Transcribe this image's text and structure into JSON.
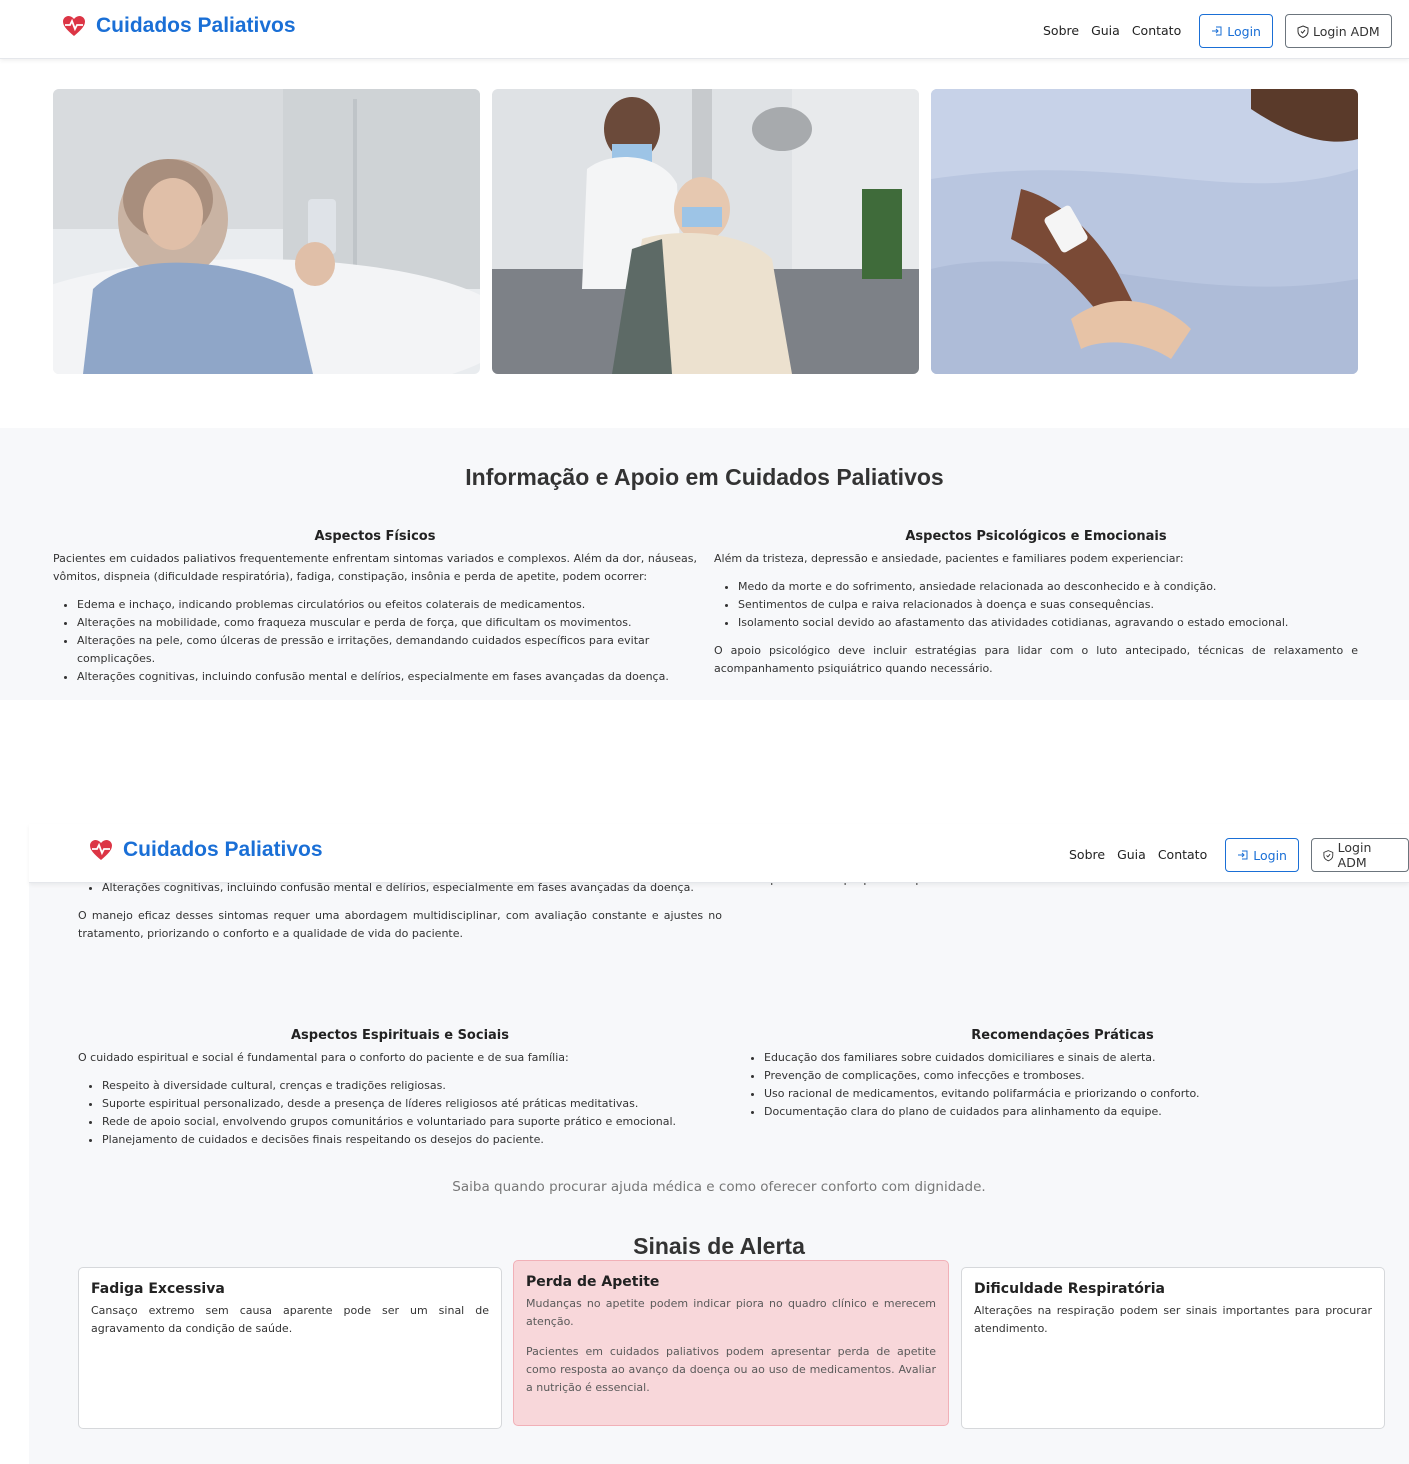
{
  "brand": {
    "name": "Cuidados Paliativos",
    "icon": "heart-pulse-icon",
    "color": "#1a6fd6"
  },
  "nav": {
    "links": [
      "Sobre",
      "Guia",
      "Contato"
    ],
    "login_label": "Login",
    "login_adm_label": "Login ADM"
  },
  "gallery": [
    {
      "alt": "Paciente idosa na cama de hospital usando celular"
    },
    {
      "alt": "Profissional de saúde cuidando de paciente idosa com máscara"
    },
    {
      "alt": "Mãos segurando paciente com acesso intravenoso"
    }
  ],
  "info": {
    "title": "Informação e Apoio em Cuidados Paliativos",
    "fisicos": {
      "title": "Aspectos Físicos",
      "intro": "Pacientes em cuidados paliativos frequentemente enfrentam sintomas variados e complexos. Além da dor, náuseas, vômitos, dispneia (dificuldade respiratória), fadiga, constipação, insônia e perda de apetite, podem ocorrer:",
      "items": [
        "Edema e inchaço, indicando problemas circulatórios ou efeitos colaterais de medicamentos.",
        "Alterações na mobilidade, como fraqueza muscular e perda de força, que dificultam os movimentos.",
        "Alterações na pele, como úlceras de pressão e irritações, demandando cuidados específicos para evitar complicações.",
        "Alterações cognitivas, incluindo confusão mental e delírios, especialmente em fases avançadas da doença."
      ],
      "outro": "O manejo eficaz desses sintomas requer uma abordagem multidisciplinar, com avaliação constante e ajustes no tratamento, priorizando o conforto e a qualidade de vida do paciente."
    },
    "psicologicos": {
      "title": "Aspectos Psicológicos e Emocionais",
      "intro": "Além da tristeza, depressão e ansiedade, pacientes e familiares podem experienciar:",
      "items": [
        "Medo da morte e do sofrimento, ansiedade relacionada ao desconhecido e à condição.",
        "Sentimentos de culpa e raiva relacionados à doença e suas consequências.",
        "Isolamento social devido ao afastamento das atividades cotidianas, agravando o estado emocional."
      ],
      "outro": "O apoio psicológico deve incluir estratégias para lidar com o luto antecipado, técnicas de relaxamento e acompanhamento psiquiátrico quando necessário."
    },
    "espirituais": {
      "title": "Aspectos Espirituais e Sociais",
      "intro": "O cuidado espiritual e social é fundamental para o conforto do paciente e de sua família:",
      "items": [
        "Respeito à diversidade cultural, crenças e tradições religiosas.",
        "Suporte espiritual personalizado, desde a presença de líderes religiosos até práticas meditativas.",
        "Rede de apoio social, envolvendo grupos comunitários e voluntariado para suporte prático e emocional.",
        "Planejamento de cuidados e decisões finais respeitando os desejos do paciente."
      ]
    },
    "recomendacoes": {
      "title": "Recomendações Práticas",
      "items": [
        "Educação dos familiares sobre cuidados domiciliares e sinais de alerta.",
        "Prevenção de complicações, como infecções e tromboses.",
        "Uso racional de medicamentos, evitando polifarmácia e priorizando o conforto.",
        "Documentação clara do plano de cuidados para alinhamento da equipe."
      ]
    }
  },
  "subtitle": "Saiba quando procurar ajuda médica e como oferecer conforto com dignidade.",
  "alerts": {
    "title": "Sinais de Alerta",
    "cards": [
      {
        "title": "Fadiga Excessiva",
        "text": "Cansaço extremo sem causa aparente pode ser um sinal de agravamento da condição de saúde."
      },
      {
        "title": "Perda de Apetite",
        "text": "Mudanças no apetite podem indicar piora no quadro clínico e merecem atenção.",
        "extra": "Pacientes em cuidados paliativos podem apresentar perda de apetite como resposta ao avanço da doença ou ao uso de medicamentos. Avaliar a nutrição é essencial."
      },
      {
        "title": "Dificuldade Respiratória",
        "text": "Alterações na respiração podem ser sinais importantes para procurar atendimento."
      }
    ]
  }
}
